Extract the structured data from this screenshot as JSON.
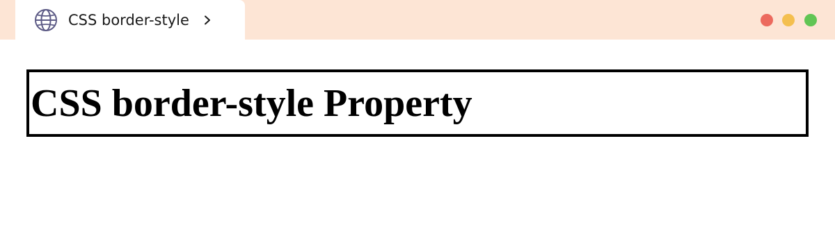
{
  "browser": {
    "tab": {
      "title": "CSS border-style",
      "icon": "globe-icon",
      "chevron_icon": "chevron-right-icon"
    },
    "window_controls": {
      "close_color": "#ec6a5e",
      "minimize_color": "#f4bf4f",
      "maximize_color": "#61c554"
    },
    "titlebar_color": "#fde5d5"
  },
  "page": {
    "heading": "CSS border-style Property"
  }
}
